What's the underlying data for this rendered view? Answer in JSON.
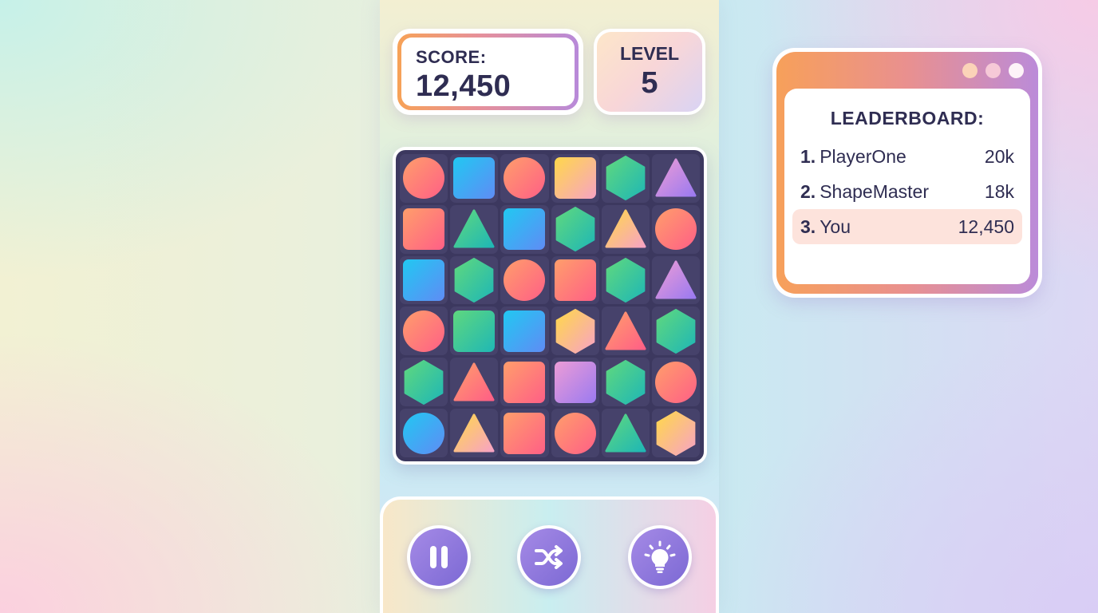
{
  "hud": {
    "score_label": "SCORE:",
    "score_value": "12,450",
    "level_label": "LEVEL",
    "level_value": "5"
  },
  "board": {
    "rows": 6,
    "cols": 6,
    "tiles": [
      [
        "circle-coral",
        "square-blue",
        "circle-coral",
        "square-yellow",
        "hexagon-green",
        "triangle-purple"
      ],
      [
        "square-coral",
        "triangle-green",
        "square-blue",
        "hexagon-green",
        "triangle-yellow",
        "circle-coral"
      ],
      [
        "square-blue",
        "hexagon-green",
        "circle-coral",
        "square-coral",
        "hexagon-green",
        "triangle-purple"
      ],
      [
        "circle-coral",
        "square-green",
        "square-blue",
        "hexagon-yellow",
        "triangle-coral",
        "hexagon-green"
      ],
      [
        "hexagon-green",
        "triangle-coral",
        "square-coral",
        "square-purple",
        "hexagon-green",
        "circle-coral"
      ],
      [
        "circle-blue",
        "triangle-yellow",
        "square-coral",
        "circle-coral",
        "triangle-green",
        "hexagon-yellow"
      ]
    ]
  },
  "controls": {
    "pause_icon": "pause-icon",
    "shuffle_icon": "shuffle-icon",
    "hint_icon": "lightbulb-icon"
  },
  "leaderboard": {
    "title": "LEADERBOARD:",
    "entries": [
      {
        "rank": "1.",
        "name": "PlayerOne",
        "score": "20k"
      },
      {
        "rank": "2.",
        "name": "ShapeMaster",
        "score": "18k"
      },
      {
        "rank": "3.",
        "name": "You",
        "score": "12,450"
      }
    ],
    "window_dots": [
      "#fbd3b8",
      "#f6c9d7",
      "#fdf3f8"
    ]
  },
  "colors": {
    "coral": [
      "#ff9e6b",
      "#ff5f86"
    ],
    "blue": [
      "#21c8f2",
      "#5f8cf5"
    ],
    "green": [
      "#5fd87e",
      "#1fb7b5"
    ],
    "yellow": [
      "#ffd84a",
      "#f7a3c4"
    ],
    "purple": [
      "#ec9cd6",
      "#9b7af0"
    ],
    "text": "#2f2d52",
    "board_bg": "#3c385f",
    "button": "#8f78dd"
  }
}
